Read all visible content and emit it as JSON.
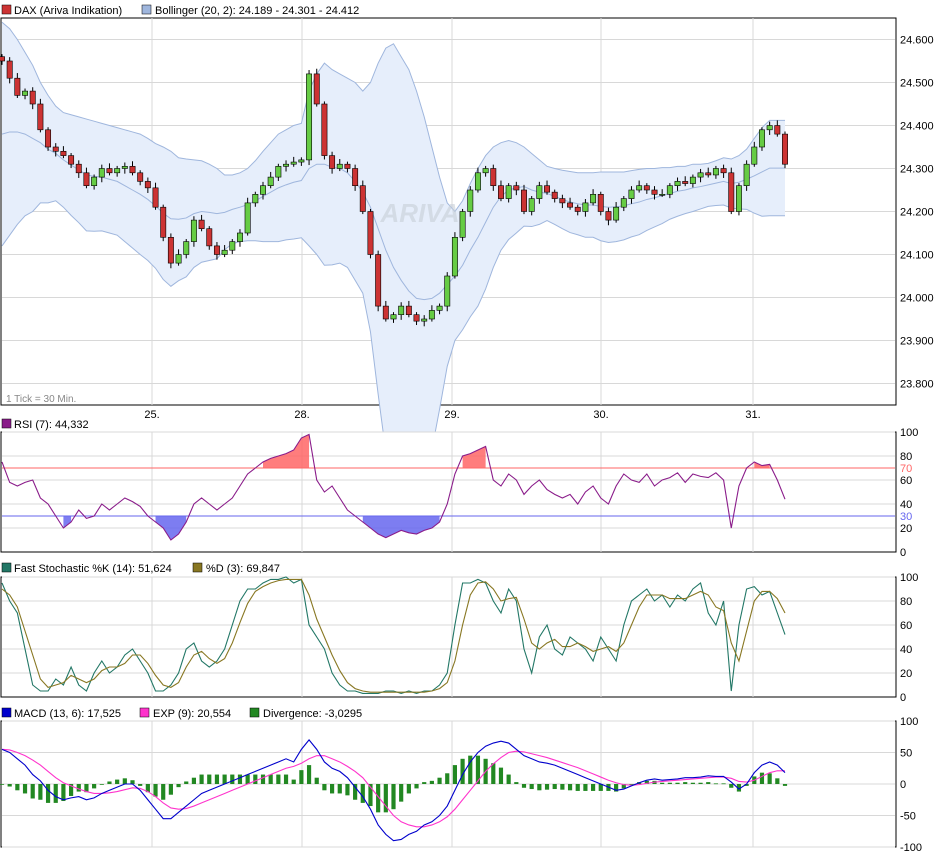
{
  "colors": {
    "up": "#66cc44",
    "down": "#cc3333",
    "band_fill": "#e6eefb",
    "band_line": "#9fb6dd",
    "grid": "#d8d8d8",
    "rsi_line": "#8a1c8a",
    "rsi_upper": "#ff6666",
    "rsi_lower": "#6666ee",
    "stoch_k": "#227766",
    "stoch_d": "#887722",
    "macd": "#0000cc",
    "exp": "#ff33cc",
    "divergence": "#228822",
    "frame": "#000000"
  },
  "chart_data": [
    {
      "type": "candlestick",
      "legend": [
        {
          "name": "DAX (Ariva Indikation)",
          "color": "#cc3333"
        },
        {
          "name": "Bollinger (20, 2): 24.189 - 24.301 - 24.412",
          "color": "#9fb6dd"
        }
      ],
      "ylim": [
        23750,
        24650
      ],
      "y_ticks": [
        "24.600",
        "24.500",
        "24.400",
        "24.300",
        "24.200",
        "24.100",
        "24.000",
        "23.900",
        "23.800"
      ],
      "x_labels": [
        "25.",
        "28.",
        "29.",
        "30.",
        "31."
      ],
      "footnote": "1 Tick = 30 Min.",
      "watermark": "ARIVA",
      "close": [
        24550,
        24510,
        24470,
        24480,
        24450,
        24390,
        24350,
        24340,
        24330,
        24310,
        24290,
        24260,
        24280,
        24300,
        24290,
        24300,
        24305,
        24290,
        24270,
        24255,
        24210,
        24140,
        24080,
        24100,
        24130,
        24180,
        24160,
        24120,
        24100,
        24110,
        24130,
        24150,
        24220,
        24240,
        24260,
        24280,
        24305,
        24310,
        24315,
        24320,
        24520,
        24450,
        24330,
        24300,
        24310,
        24300,
        24260,
        24200,
        24100,
        23980,
        23950,
        23960,
        23980,
        23960,
        23945,
        23950,
        23970,
        23980,
        24050,
        24140,
        24200,
        24250,
        24290,
        24300,
        24260,
        24230,
        24260,
        24250,
        24200,
        24230,
        24260,
        24245,
        24230,
        24220,
        24210,
        24200,
        24220,
        24240,
        24200,
        24180,
        24210,
        24230,
        24250,
        24260,
        24250,
        24240,
        24240,
        24260,
        24270,
        24265,
        24280,
        24290,
        24285,
        24300,
        24290,
        24200,
        24260,
        24310,
        24350,
        24390,
        24400,
        24380,
        24310
      ],
      "bollinger_mid": [
        24380,
        24385,
        24385,
        24380,
        24370,
        24360,
        24345,
        24335,
        24320,
        24308,
        24297,
        24285,
        24282,
        24280,
        24275,
        24270,
        24260,
        24250,
        24240,
        24228,
        24213,
        24196,
        24183,
        24182,
        24185,
        24195,
        24200,
        24198,
        24195,
        24198,
        24205,
        24210,
        24216,
        24225,
        24235,
        24245,
        24255,
        24262,
        24268,
        24272,
        24300,
        24310,
        24310,
        24303,
        24300,
        24290,
        24270,
        24245,
        24210,
        24160,
        24110,
        24070,
        24040,
        24015,
        23998,
        23995,
        23998,
        24010,
        24030,
        24050,
        24075,
        24110,
        24140,
        24175,
        24210,
        24235,
        24250,
        24255,
        24258,
        24250,
        24245,
        24242,
        24235,
        24228,
        24222,
        24218,
        24215,
        24215,
        24212,
        24210,
        24211,
        24213,
        24218,
        24222,
        24228,
        24232,
        24237,
        24242,
        24247,
        24250,
        24255,
        24258,
        24262,
        24266,
        24270,
        24265,
        24268,
        24275,
        24283,
        24292,
        24301,
        24301,
        24301
      ],
      "bollinger_upper": [
        24640,
        24625,
        24600,
        24570,
        24540,
        24500,
        24470,
        24445,
        24430,
        24425,
        24420,
        24415,
        24410,
        24405,
        24400,
        24395,
        24390,
        24385,
        24380,
        24370,
        24358,
        24350,
        24340,
        24325,
        24322,
        24320,
        24318,
        24310,
        24300,
        24285,
        24285,
        24290,
        24300,
        24318,
        24340,
        24360,
        24380,
        24390,
        24400,
        24405,
        24480,
        24520,
        24545,
        24530,
        24520,
        24510,
        24500,
        24480,
        24500,
        24545,
        24580,
        24590,
        24560,
        24530,
        24480,
        24420,
        24350,
        24280,
        24220,
        24200,
        24225,
        24265,
        24300,
        24330,
        24350,
        24360,
        24365,
        24360,
        24350,
        24335,
        24320,
        24305,
        24300,
        24296,
        24293,
        24290,
        24290,
        24290,
        24292,
        24292,
        24292,
        24292,
        24295,
        24298,
        24300,
        24300,
        24302,
        24302,
        24305,
        24305,
        24310,
        24310,
        24312,
        24318,
        24325,
        24322,
        24330,
        24345,
        24370,
        24395,
        24412,
        24412,
        24412
      ],
      "bollinger_lower": [
        24120,
        24145,
        24170,
        24190,
        24200,
        24220,
        24220,
        24225,
        24210,
        24191,
        24174,
        24155,
        24154,
        24155,
        24150,
        24145,
        24130,
        24115,
        24100,
        24086,
        24068,
        24042,
        24026,
        24039,
        24048,
        24070,
        24082,
        24086,
        24090,
        24111,
        24125,
        24130,
        24132,
        24132,
        24130,
        24130,
        24130,
        24134,
        24136,
        24139,
        24120,
        24100,
        24075,
        24076,
        24080,
        24070,
        24040,
        24010,
        23920,
        23775,
        23640,
        23550,
        23520,
        23500,
        23516,
        23570,
        23646,
        23740,
        23840,
        23900,
        23925,
        23955,
        23980,
        24020,
        24070,
        24110,
        24135,
        24150,
        24166,
        24165,
        24170,
        24179,
        24170,
        24160,
        24151,
        24146,
        24140,
        24140,
        24132,
        24128,
        24130,
        24134,
        24141,
        24146,
        24156,
        24164,
        24172,
        24182,
        24189,
        24195,
        24200,
        24206,
        24212,
        24214,
        24215,
        24208,
        24206,
        24205,
        24196,
        24189,
        24190,
        24190,
        24190
      ]
    },
    {
      "type": "line",
      "legend": [
        {
          "name": "RSI (7): 44,332",
          "color": "#8a1c8a"
        }
      ],
      "ylim": [
        0,
        100
      ],
      "y_ticks": [
        "100",
        "80",
        "70",
        "60",
        "40",
        "30",
        "20",
        "0"
      ],
      "levels": {
        "upper": 70,
        "lower": 30
      },
      "values": [
        75,
        58,
        55,
        58,
        60,
        45,
        40,
        30,
        20,
        25,
        35,
        28,
        30,
        40,
        35,
        40,
        45,
        42,
        38,
        30,
        25,
        20,
        10,
        15,
        25,
        40,
        45,
        40,
        35,
        40,
        45,
        55,
        65,
        70,
        75,
        78,
        80,
        82,
        85,
        95,
        98,
        60,
        50,
        55,
        45,
        35,
        30,
        25,
        20,
        15,
        12,
        15,
        18,
        16,
        15,
        18,
        20,
        25,
        40,
        65,
        80,
        82,
        85,
        88,
        60,
        55,
        65,
        60,
        48,
        55,
        60,
        52,
        48,
        45,
        48,
        40,
        50,
        55,
        45,
        40,
        55,
        65,
        60,
        58,
        65,
        55,
        60,
        62,
        66,
        58,
        65,
        63,
        62,
        66,
        60,
        20,
        55,
        70,
        75,
        72,
        73,
        60,
        44
      ],
      "dates": [
        "25.",
        "28.",
        "29.",
        "30.",
        "31."
      ]
    },
    {
      "type": "line",
      "legend": [
        {
          "name": "Fast Stochastic %K (14): 51,624",
          "color": "#227766"
        },
        {
          "name": "%D (3): 69,847",
          "color": "#887722"
        }
      ],
      "ylim": [
        0,
        100
      ],
      "y_ticks": [
        "100",
        "80",
        "60",
        "40",
        "20",
        "0"
      ],
      "series": [
        {
          "name": "Fast Stochastic %K (14): 51,624",
          "values": [
            95,
            80,
            70,
            40,
            10,
            5,
            5,
            15,
            10,
            25,
            10,
            5,
            20,
            30,
            20,
            25,
            35,
            40,
            30,
            20,
            5,
            5,
            10,
            20,
            40,
            45,
            30,
            25,
            30,
            40,
            60,
            80,
            90,
            90,
            95,
            98,
            98,
            100,
            95,
            98,
            60,
            50,
            40,
            20,
            10,
            5,
            5,
            3,
            3,
            3,
            5,
            5,
            3,
            5,
            3,
            5,
            5,
            10,
            20,
            60,
            95,
            95,
            98,
            95,
            80,
            70,
            90,
            80,
            40,
            20,
            50,
            60,
            40,
            35,
            50,
            45,
            40,
            30,
            50,
            40,
            30,
            60,
            80,
            85,
            90,
            80,
            85,
            75,
            85,
            80,
            90,
            95,
            70,
            60,
            80,
            5,
            60,
            90,
            92,
            85,
            88,
            70,
            52
          ]
        },
        {
          "name": "%D (3): 69,847",
          "values": [
            90,
            85,
            75,
            55,
            35,
            15,
            8,
            10,
            12,
            18,
            15,
            12,
            15,
            22,
            25,
            25,
            28,
            35,
            35,
            28,
            18,
            10,
            8,
            12,
            25,
            35,
            38,
            32,
            28,
            32,
            45,
            62,
            78,
            88,
            92,
            95,
            97,
            98,
            98,
            98,
            85,
            65,
            50,
            35,
            22,
            12,
            7,
            5,
            4,
            4,
            4,
            4,
            4,
            4,
            4,
            4,
            5,
            7,
            12,
            30,
            60,
            85,
            95,
            96,
            90,
            80,
            82,
            83,
            65,
            45,
            40,
            45,
            48,
            42,
            42,
            45,
            42,
            38,
            40,
            42,
            38,
            45,
            60,
            75,
            85,
            85,
            85,
            82,
            82,
            82,
            85,
            88,
            85,
            75,
            72,
            45,
            30,
            55,
            80,
            88,
            88,
            82,
            70
          ]
        }
      ]
    },
    {
      "type": "bar+line",
      "legend": [
        {
          "name": "MACD (13, 6): 17,525",
          "color": "#0000cc"
        },
        {
          "name": "EXP (9): 20,554",
          "color": "#ff33cc"
        },
        {
          "name": "Divergence: -3,0295",
          "color": "#228822"
        }
      ],
      "ylim": [
        -100,
        100
      ],
      "y_ticks": [
        "100",
        "50",
        "0",
        "-50",
        "-100"
      ],
      "series": [
        {
          "name": "MACD (13, 6): 17,525",
          "values": [
            55,
            50,
            40,
            30,
            15,
            5,
            -10,
            -20,
            -25,
            -22,
            -20,
            -25,
            -22,
            -15,
            -10,
            -5,
            0,
            0,
            -10,
            -25,
            -40,
            -55,
            -55,
            -45,
            -35,
            -25,
            -15,
            -10,
            -5,
            0,
            5,
            10,
            15,
            20,
            25,
            30,
            35,
            40,
            35,
            55,
            70,
            55,
            35,
            25,
            20,
            10,
            -5,
            -20,
            -40,
            -65,
            -80,
            -90,
            -88,
            -80,
            -75,
            -65,
            -60,
            -50,
            -35,
            -10,
            15,
            35,
            50,
            60,
            65,
            68,
            65,
            55,
            45,
            40,
            35,
            33,
            30,
            25,
            20,
            15,
            10,
            5,
            0,
            -5,
            -10,
            -8,
            -3,
            2,
            6,
            8,
            6,
            7,
            8,
            10,
            10,
            11,
            13,
            12,
            12,
            3,
            -8,
            0,
            18,
            30,
            35,
            30,
            18
          ]
        },
        {
          "name": "EXP (9): 20,554",
          "values": [
            55,
            54,
            50,
            45,
            38,
            30,
            20,
            10,
            2,
            -3,
            -8,
            -12,
            -15,
            -15,
            -14,
            -12,
            -9,
            -6,
            -7,
            -12,
            -20,
            -30,
            -38,
            -40,
            -39,
            -35,
            -30,
            -25,
            -20,
            -15,
            -10,
            -5,
            0,
            5,
            10,
            15,
            20,
            25,
            28,
            33,
            40,
            45,
            45,
            40,
            35,
            28,
            20,
            10,
            -5,
            -20,
            -35,
            -50,
            -60,
            -65,
            -68,
            -68,
            -65,
            -60,
            -52,
            -40,
            -25,
            -10,
            5,
            20,
            32,
            42,
            50,
            52,
            51,
            48,
            45,
            42,
            38,
            34,
            30,
            26,
            21,
            16,
            11,
            6,
            2,
            -1,
            -2,
            -1,
            1,
            3,
            4,
            5,
            6,
            7,
            8,
            9,
            10,
            11,
            11,
            9,
            4,
            3,
            6,
            12,
            18,
            21,
            21
          ]
        },
        {
          "name": "Divergence: -3,0295",
          "values": [
            0,
            -4,
            -10,
            -15,
            -23,
            -25,
            -30,
            -30,
            -27,
            -19,
            -12,
            -13,
            -7,
            0,
            4,
            7,
            9,
            6,
            -3,
            -13,
            -20,
            -25,
            -17,
            -5,
            4,
            10,
            15,
            15,
            15,
            15,
            15,
            15,
            15,
            15,
            15,
            15,
            15,
            15,
            7,
            22,
            30,
            10,
            -10,
            -15,
            -15,
            -18,
            -25,
            -30,
            -35,
            -45,
            -45,
            -40,
            -28,
            -15,
            -7,
            3,
            5,
            10,
            17,
            30,
            40,
            45,
            45,
            40,
            33,
            26,
            15,
            3,
            -6,
            -8,
            -10,
            -9,
            -8,
            -9,
            -10,
            -11,
            -11,
            -11,
            -11,
            -11,
            -12,
            -7,
            -1,
            3,
            5,
            5,
            2,
            2,
            2,
            3,
            2,
            2,
            3,
            1,
            1,
            -6,
            -12,
            -3,
            12,
            18,
            17,
            9,
            -3
          ]
        }
      ]
    }
  ]
}
